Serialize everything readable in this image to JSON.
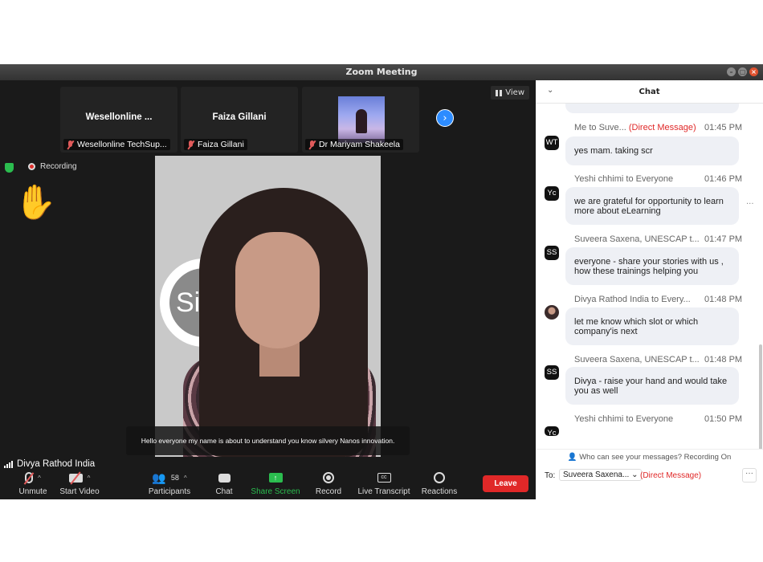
{
  "window": {
    "title": "Zoom Meeting"
  },
  "gallery": {
    "tiles": [
      {
        "big_name": "Wesellonline ...",
        "name": "Wesellonline TechSup..."
      },
      {
        "big_name": "Faiza Gillani",
        "name": "Faiza Gillani"
      },
      {
        "name": "Dr Mariyam Shakeela"
      }
    ],
    "view_label": "View"
  },
  "status": {
    "recording": "Recording"
  },
  "video": {
    "logo_text": "Sil",
    "caption": "Hello everyone my name is about to understand you know silvery Nanos innovation.",
    "speaker": "Divya Rathod India"
  },
  "toolbar": {
    "unmute": "Unmute",
    "start_video": "Start Video",
    "participants": "Participants",
    "participants_count": "58",
    "chat": "Chat",
    "share_screen": "Share Screen",
    "record": "Record",
    "live_transcript": "Live Transcript",
    "reactions": "Reactions",
    "leave": "Leave"
  },
  "chat": {
    "title": "Chat",
    "messages": [
      {
        "sender": "Me to Suve...",
        "direct": "(Direct Message)",
        "time": "01:45 PM",
        "avatar": "WT",
        "text": "yes mam. taking scr"
      },
      {
        "sender": "Yeshi chhimi to Everyone",
        "time": "01:46 PM",
        "avatar": "Yc",
        "text": "we are grateful for opportunity to learn more about eLearning"
      },
      {
        "sender": "Suveera Saxena, UNESCAP t...",
        "time": "01:47 PM",
        "avatar": "SS",
        "text": "everyone - share your stories with us , how these trainings helping you"
      },
      {
        "sender": "Divya Rathod India to Every...",
        "time": "01:48 PM",
        "avatar": "",
        "text": "let me know which slot or which company'is next"
      },
      {
        "sender": "Suveera Saxena, UNESCAP t...",
        "time": "01:48 PM",
        "avatar": "SS",
        "text": "Divya - raise your hand and would take you as well"
      },
      {
        "sender": "Yeshi chhimi to Everyone",
        "time": "01:50 PM",
        "avatar": "Yc"
      }
    ],
    "notice": "Who can see your messages? Recording On",
    "to_label": "To:",
    "recipient": "Suveera Saxena...",
    "recipient_mode": "(Direct Message)"
  }
}
